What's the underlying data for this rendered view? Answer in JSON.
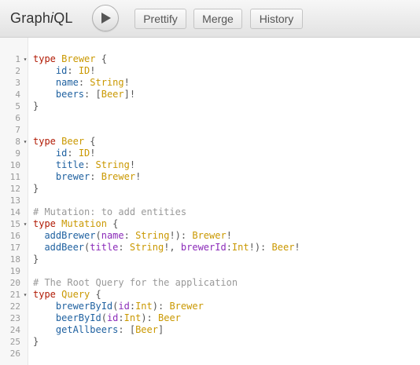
{
  "app": {
    "title_prefix": "Graph",
    "title_italic": "i",
    "title_suffix": "QL"
  },
  "toolbar": {
    "run_icon": "play-icon",
    "prettify_label": "Prettify",
    "merge_label": "Merge",
    "history_label": "History"
  },
  "editor": {
    "lines": [
      {
        "n": "1",
        "fold": true,
        "tokens": [
          [
            "kw",
            "type"
          ],
          [
            "pu",
            " "
          ],
          [
            "tn",
            "Brewer"
          ],
          [
            "pu",
            " {"
          ]
        ]
      },
      {
        "n": "2",
        "fold": false,
        "tokens": [
          [
            "pu",
            "    "
          ],
          [
            "fd",
            "id"
          ],
          [
            "pu",
            ": "
          ],
          [
            "tn",
            "ID"
          ],
          [
            "pu",
            "!"
          ]
        ]
      },
      {
        "n": "3",
        "fold": false,
        "tokens": [
          [
            "pu",
            "    "
          ],
          [
            "fd",
            "name"
          ],
          [
            "pu",
            ": "
          ],
          [
            "tn",
            "String"
          ],
          [
            "pu",
            "!"
          ]
        ]
      },
      {
        "n": "4",
        "fold": false,
        "tokens": [
          [
            "pu",
            "    "
          ],
          [
            "fd",
            "beers"
          ],
          [
            "pu",
            ": ["
          ],
          [
            "tn",
            "Beer"
          ],
          [
            "pu",
            "]!"
          ]
        ]
      },
      {
        "n": "5",
        "fold": false,
        "tokens": [
          [
            "pu",
            "}"
          ]
        ]
      },
      {
        "n": "6",
        "fold": false,
        "tokens": []
      },
      {
        "n": "7",
        "fold": false,
        "tokens": []
      },
      {
        "n": "8",
        "fold": true,
        "tokens": [
          [
            "kw",
            "type"
          ],
          [
            "pu",
            " "
          ],
          [
            "tn",
            "Beer"
          ],
          [
            "pu",
            " {"
          ]
        ]
      },
      {
        "n": "9",
        "fold": false,
        "tokens": [
          [
            "pu",
            "    "
          ],
          [
            "fd",
            "id"
          ],
          [
            "pu",
            ": "
          ],
          [
            "tn",
            "ID"
          ],
          [
            "pu",
            "!"
          ]
        ]
      },
      {
        "n": "10",
        "fold": false,
        "tokens": [
          [
            "pu",
            "    "
          ],
          [
            "fd",
            "title"
          ],
          [
            "pu",
            ": "
          ],
          [
            "tn",
            "String"
          ],
          [
            "pu",
            "!"
          ]
        ]
      },
      {
        "n": "11",
        "fold": false,
        "tokens": [
          [
            "pu",
            "    "
          ],
          [
            "fd",
            "brewer"
          ],
          [
            "pu",
            ": "
          ],
          [
            "tn",
            "Brewer"
          ],
          [
            "pu",
            "!"
          ]
        ]
      },
      {
        "n": "12",
        "fold": false,
        "tokens": [
          [
            "pu",
            "}"
          ]
        ]
      },
      {
        "n": "13",
        "fold": false,
        "tokens": []
      },
      {
        "n": "14",
        "fold": false,
        "tokens": [
          [
            "cm",
            "# Mutation: to add entities"
          ]
        ]
      },
      {
        "n": "15",
        "fold": true,
        "tokens": [
          [
            "kw",
            "type"
          ],
          [
            "pu",
            " "
          ],
          [
            "tn",
            "Mutation"
          ],
          [
            "pu",
            " {"
          ]
        ]
      },
      {
        "n": "16",
        "fold": false,
        "tokens": [
          [
            "pu",
            "  "
          ],
          [
            "fd",
            "addBrewer"
          ],
          [
            "pu",
            "("
          ],
          [
            "at",
            "name"
          ],
          [
            "pu",
            ": "
          ],
          [
            "tn",
            "String"
          ],
          [
            "pu",
            "!): "
          ],
          [
            "tn",
            "Brewer"
          ],
          [
            "pu",
            "!"
          ]
        ]
      },
      {
        "n": "17",
        "fold": false,
        "tokens": [
          [
            "pu",
            "  "
          ],
          [
            "fd",
            "addBeer"
          ],
          [
            "pu",
            "("
          ],
          [
            "at",
            "title"
          ],
          [
            "pu",
            ": "
          ],
          [
            "tn",
            "String"
          ],
          [
            "pu",
            "!, "
          ],
          [
            "at",
            "brewerId"
          ],
          [
            "pu",
            ":"
          ],
          [
            "tn",
            "Int"
          ],
          [
            "pu",
            "!): "
          ],
          [
            "tn",
            "Beer"
          ],
          [
            "pu",
            "!"
          ]
        ]
      },
      {
        "n": "18",
        "fold": false,
        "tokens": [
          [
            "pu",
            "}"
          ]
        ]
      },
      {
        "n": "19",
        "fold": false,
        "tokens": []
      },
      {
        "n": "20",
        "fold": false,
        "tokens": [
          [
            "cm",
            "# The Root Query for the application"
          ]
        ]
      },
      {
        "n": "21",
        "fold": true,
        "tokens": [
          [
            "kw",
            "type"
          ],
          [
            "pu",
            " "
          ],
          [
            "tn",
            "Query"
          ],
          [
            "pu",
            " {"
          ]
        ]
      },
      {
        "n": "22",
        "fold": false,
        "tokens": [
          [
            "pu",
            "    "
          ],
          [
            "fd",
            "brewerById"
          ],
          [
            "pu",
            "("
          ],
          [
            "at",
            "id"
          ],
          [
            "pu",
            ":"
          ],
          [
            "tn",
            "Int"
          ],
          [
            "pu",
            "): "
          ],
          [
            "tn",
            "Brewer"
          ]
        ]
      },
      {
        "n": "23",
        "fold": false,
        "tokens": [
          [
            "pu",
            "    "
          ],
          [
            "fd",
            "beerById"
          ],
          [
            "pu",
            "("
          ],
          [
            "at",
            "id"
          ],
          [
            "pu",
            ":"
          ],
          [
            "tn",
            "Int"
          ],
          [
            "pu",
            "): "
          ],
          [
            "tn",
            "Beer"
          ]
        ]
      },
      {
        "n": "24",
        "fold": false,
        "tokens": [
          [
            "pu",
            "    "
          ],
          [
            "fd",
            "getAllbeers"
          ],
          [
            "pu",
            ": ["
          ],
          [
            "tn",
            "Beer"
          ],
          [
            "pu",
            "]"
          ]
        ]
      },
      {
        "n": "25",
        "fold": false,
        "tokens": [
          [
            "pu",
            "}"
          ]
        ]
      },
      {
        "n": "26",
        "fold": false,
        "tokens": []
      }
    ]
  }
}
